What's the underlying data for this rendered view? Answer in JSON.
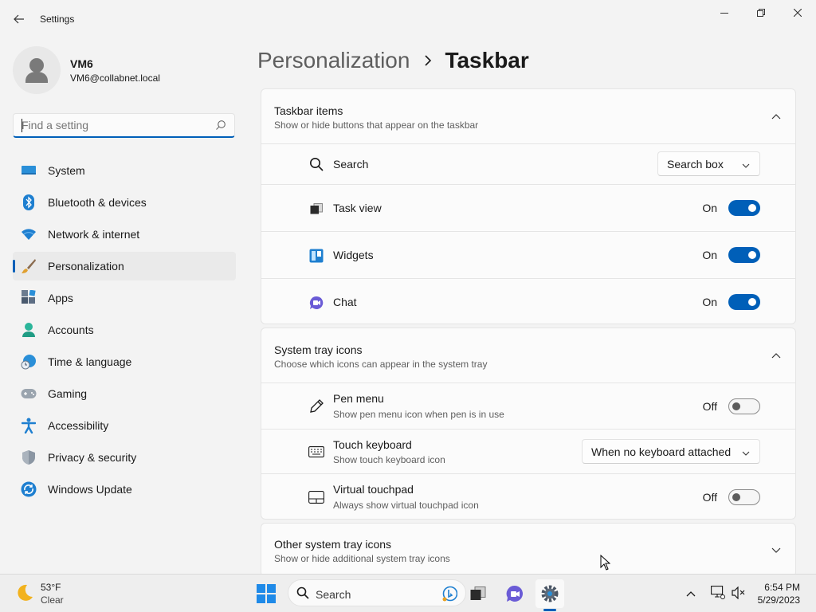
{
  "window": {
    "title": "Settings"
  },
  "user": {
    "name": "VM6",
    "email": "VM6@collabnet.local"
  },
  "search": {
    "placeholder": "Find a setting"
  },
  "sidebar": {
    "items": [
      {
        "label": "System",
        "icon": "system-icon",
        "active": false
      },
      {
        "label": "Bluetooth & devices",
        "icon": "bluetooth-icon",
        "active": false
      },
      {
        "label": "Network & internet",
        "icon": "wifi-icon",
        "active": false
      },
      {
        "label": "Personalization",
        "icon": "brush-icon",
        "active": true
      },
      {
        "label": "Apps",
        "icon": "apps-icon",
        "active": false
      },
      {
        "label": "Accounts",
        "icon": "accounts-icon",
        "active": false
      },
      {
        "label": "Time & language",
        "icon": "globe-clock-icon",
        "active": false
      },
      {
        "label": "Gaming",
        "icon": "gamepad-icon",
        "active": false
      },
      {
        "label": "Accessibility",
        "icon": "accessibility-icon",
        "active": false
      },
      {
        "label": "Privacy & security",
        "icon": "shield-icon",
        "active": false
      },
      {
        "label": "Windows Update",
        "icon": "update-icon",
        "active": false
      }
    ]
  },
  "breadcrumb": {
    "parent": "Personalization",
    "current": "Taskbar"
  },
  "taskbar_items": {
    "title": "Taskbar items",
    "subtitle": "Show or hide buttons that appear on the taskbar",
    "search": {
      "label": "Search",
      "value": "Search box"
    },
    "task_view": {
      "label": "Task view",
      "state": "On"
    },
    "widgets": {
      "label": "Widgets",
      "state": "On"
    },
    "chat": {
      "label": "Chat",
      "state": "On"
    }
  },
  "system_tray": {
    "title": "System tray icons",
    "subtitle": "Choose which icons can appear in the system tray",
    "pen_menu": {
      "label": "Pen menu",
      "description": "Show pen menu icon when pen is in use",
      "state": "Off"
    },
    "touch_keyboard": {
      "label": "Touch keyboard",
      "description": "Show touch keyboard icon",
      "value": "When no keyboard attached"
    },
    "virtual_touchpad": {
      "label": "Virtual touchpad",
      "description": "Always show virtual touchpad icon",
      "state": "Off"
    }
  },
  "other_tray": {
    "title": "Other system tray icons",
    "subtitle": "Show or hide additional system tray icons"
  },
  "taskbar": {
    "weather_temp": "53°F",
    "weather_cond": "Clear",
    "search_label": "Search",
    "time": "6:54 PM",
    "date": "5/29/2023"
  },
  "colors": {
    "accent": "#005fb8",
    "background": "#f3f3f3",
    "card": "#fbfbfb"
  }
}
